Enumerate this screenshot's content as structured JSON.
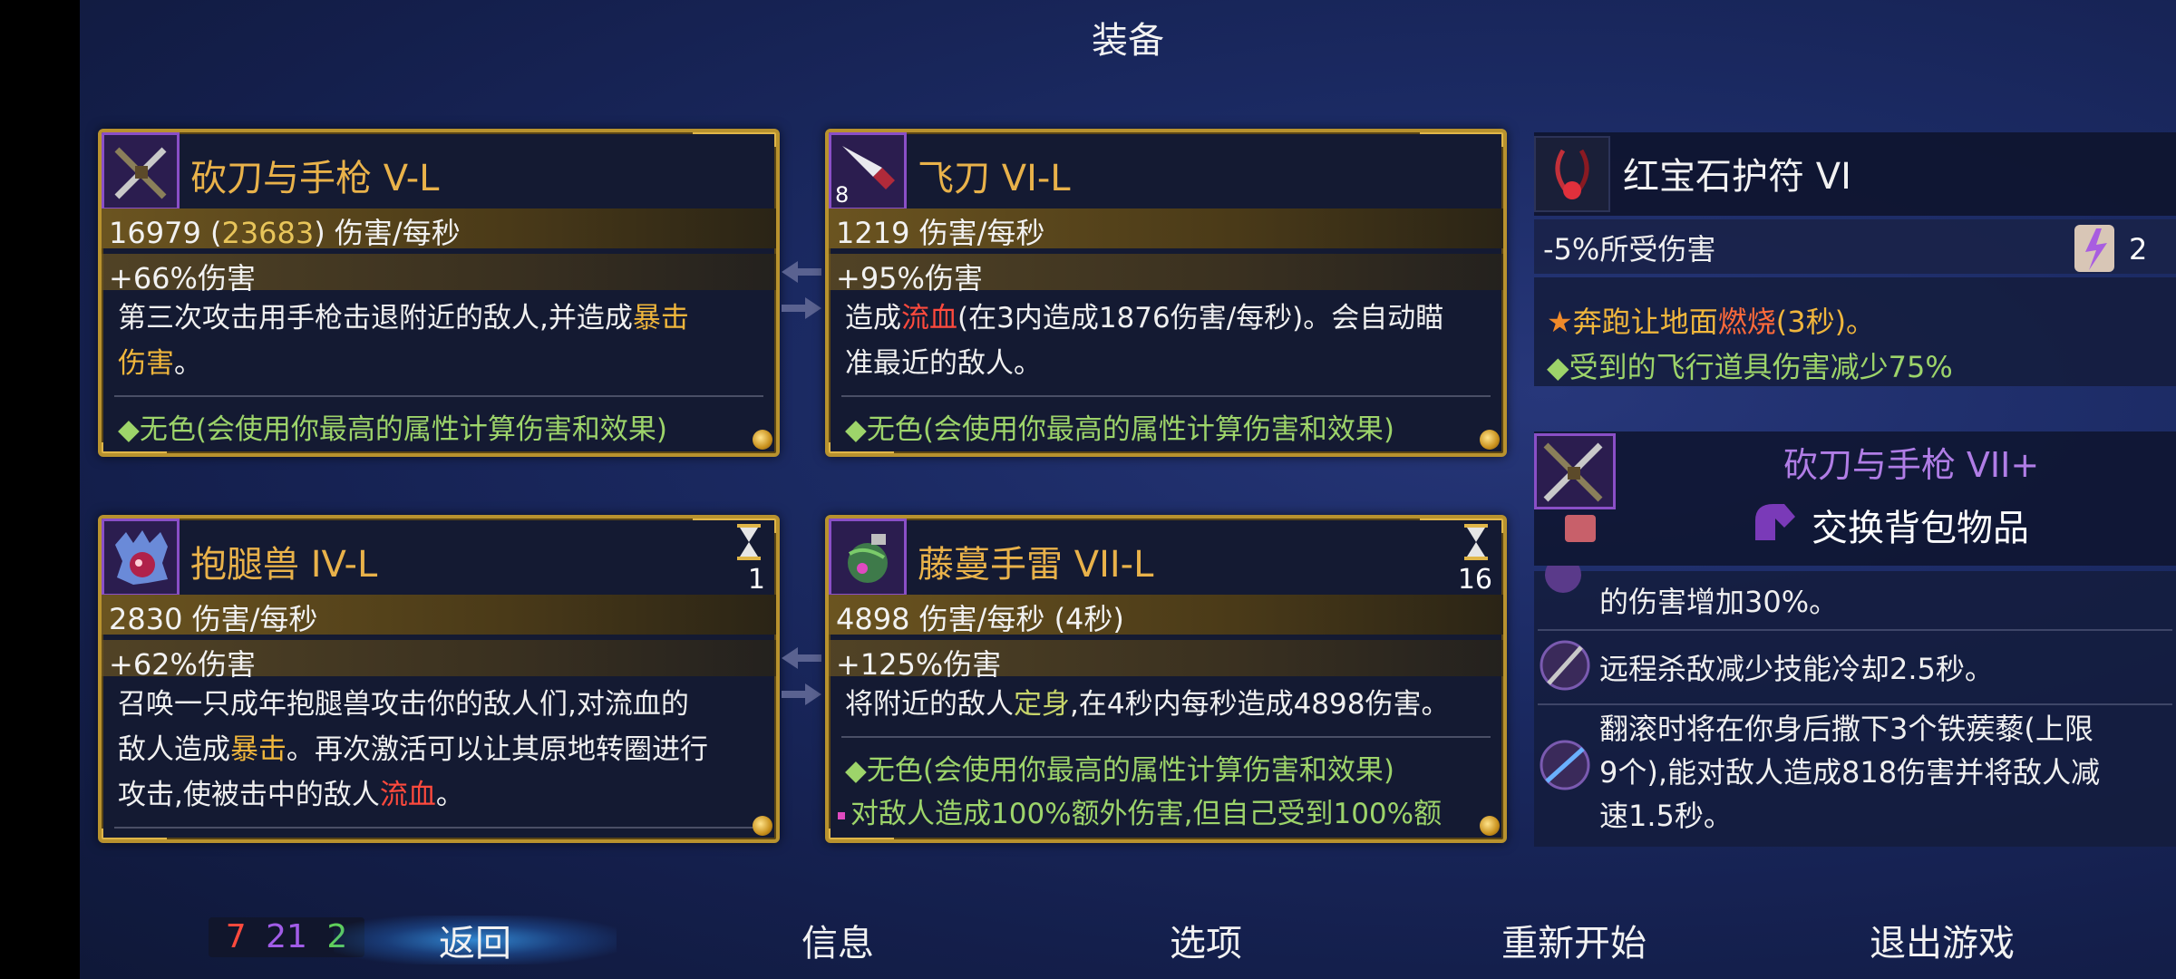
{
  "screen_title": "装备",
  "cards": [
    {
      "name": "砍刀与手枪 V-L",
      "stat_main": "16979",
      "stat_bracket": "23683",
      "stat_unit": "伤害/每秒",
      "stat_bonus": "+66%伤害",
      "desc_1": "第三次攻击用手枪击退附近的敌人,并造成",
      "desc_1_hl": "暴击",
      "desc_2_hl": "伤害",
      "desc_2": "。",
      "affix": "◆无色(会使用你最高的属性计算伤害和效果)"
    },
    {
      "name": "飞刀 VI-L",
      "icon_count": "8",
      "stat_main": "1219",
      "stat_unit": "伤害/每秒",
      "stat_bonus": "+95%伤害",
      "desc_1a": "造成",
      "desc_1_hl": "流血",
      "desc_1b": "(在3内造成1876伤害/每秒)。会自动瞄",
      "desc_2": "准最近的敌人。",
      "affix": "◆无色(会使用你最高的属性计算伤害和效果)"
    },
    {
      "name": "抱腿兽 IV-L",
      "cooldown": "1",
      "stat_main": "2830",
      "stat_unit": "伤害/每秒",
      "stat_bonus": "+62%伤害",
      "desc_1": "召唤一只成年抱腿兽攻击你的敌人们,对流血的",
      "desc_2a": "敌人造成",
      "desc_2_hl": "暴击",
      "desc_2b": "。再次激活可以让其原地转圈进行",
      "desc_3a": "攻击,使被击中的敌人",
      "desc_3_hl": "流血",
      "desc_3b": "。"
    },
    {
      "name": "藤蔓手雷 VII-L",
      "cooldown": "16",
      "stat_main": "4898",
      "stat_unit": "伤害/每秒 (4秒)",
      "stat_bonus": "+125%伤害",
      "desc_1a": "将附近的敌人",
      "desc_1_hl": "定身",
      "desc_1b": ",在4秒内每秒造成4898伤害。",
      "affix": "◆无色(会使用你最高的属性计算伤害和效果)",
      "affix_2": "对敌人造成100%额外伤害,但自己受到100%额"
    }
  ],
  "amulet": {
    "name": "红宝石护符 VI",
    "stat": "-5%所受伤害",
    "scroll_count": "2",
    "affix_1a": "奔跑让地面",
    "affix_1_hl": "燃烧",
    "affix_1b": "(3秒)。",
    "affix_2": "◆受到的飞行道具伤害减少75%"
  },
  "backpack": {
    "name": "砍刀与手枪 VII+",
    "action": "交换背包物品"
  },
  "skills": [
    {
      "text": "的伤害增加30%。"
    },
    {
      "text": "远程杀敌减少技能冷却2.5秒。"
    },
    {
      "line1": "翻滚时将在你身后撒下3个铁蒺藜(上限",
      "line2": "9个),能对敌人造成818伤害并将敌人减",
      "line3": "速1.5秒。"
    }
  ],
  "scores": {
    "red": "7",
    "purple": "21",
    "green": "2"
  },
  "nav": {
    "back": "返回",
    "info": "信息",
    "options": "选项",
    "restart": "重新开始",
    "quit": "退出游戏"
  },
  "colors": {
    "brutality": "#ff4a3d",
    "tactics": "#a15ce8",
    "survival": "#5fcf5a",
    "gold_frame": "#b8922e"
  }
}
